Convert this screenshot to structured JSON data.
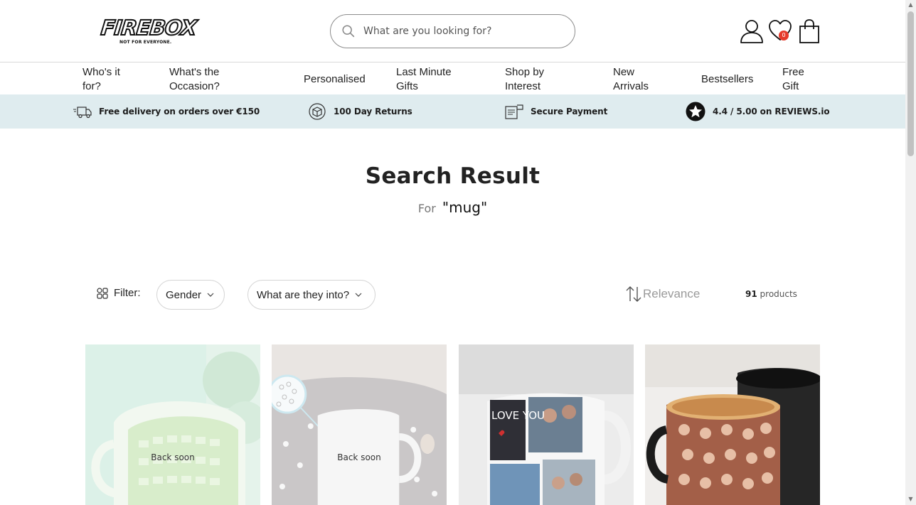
{
  "header": {
    "logo_text": "FIREBOX",
    "logo_tagline": "NOT FOR EVERYONE.",
    "search_placeholder": "What are you looking for?",
    "wishlist_count": "0",
    "icons": [
      "search-icon",
      "account-icon",
      "wishlist-heart-icon",
      "shopping-bag-icon"
    ]
  },
  "nav": {
    "items": [
      {
        "label": "Who's it for?"
      },
      {
        "label": "What's the Occasion?"
      },
      {
        "label": "Personalised"
      },
      {
        "label": "Last Minute Gifts"
      },
      {
        "label": "Shop by Interest"
      },
      {
        "label": "New Arrivals"
      },
      {
        "label": "Bestsellers"
      },
      {
        "label": "Free Gift"
      }
    ]
  },
  "usp": {
    "items": [
      {
        "text": "Free delivery on orders over €150",
        "icon": "delivery-truck-icon"
      },
      {
        "text": "100 Day Returns",
        "icon": "returns-box-icon"
      },
      {
        "text": "Secure Payment",
        "icon": "secure-payment-icon"
      },
      {
        "text": "4.4 / 5.00 on REVIEWS.io",
        "icon": "reviews-star-icon"
      }
    ]
  },
  "results": {
    "title": "Search Result",
    "for_label": "For",
    "query": "\"mug\""
  },
  "filters": {
    "label": "Filter:",
    "gender_label": "Gender",
    "interest_label": "What are they into?",
    "sort_label": "Relevance",
    "count_number": "91",
    "count_suffix": "products"
  },
  "products": [
    {
      "status": "Back soon",
      "image": "green-calendar-mug"
    },
    {
      "status": "Back soon",
      "image": "grey-speckled-mug"
    },
    {
      "status": "",
      "image": "photo-collage-mug"
    },
    {
      "status": "",
      "image": "face-print-mug"
    }
  ],
  "colors": {
    "usp_bg": "#dfecef",
    "badge": "#e63a2b",
    "text": "#222222",
    "muted": "#9a9a9a"
  }
}
